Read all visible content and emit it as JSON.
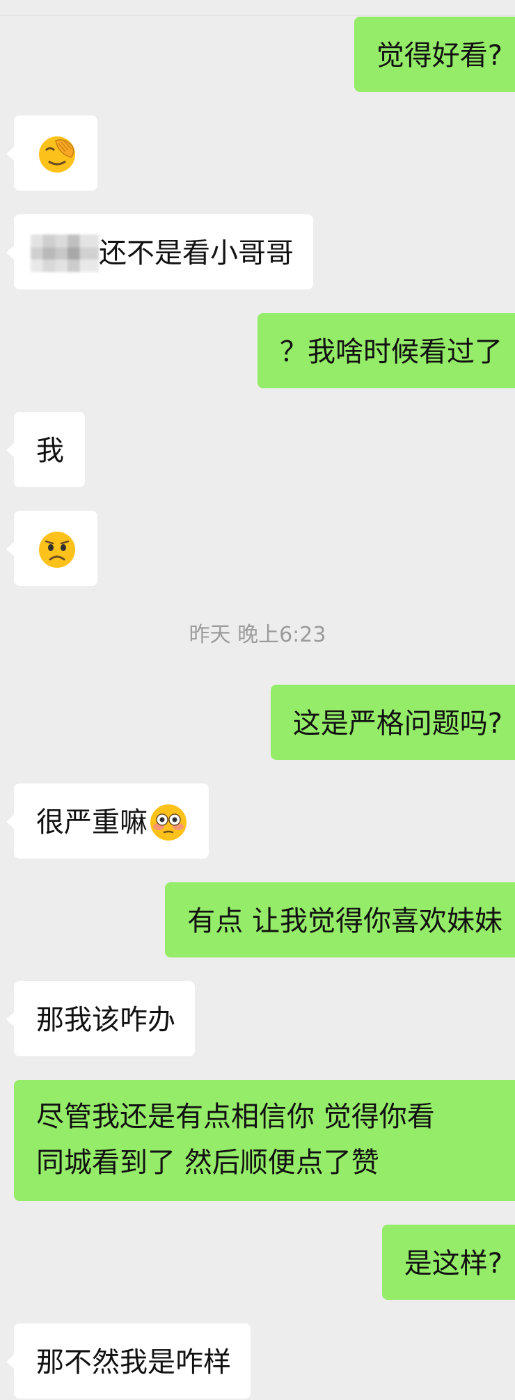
{
  "messages": [
    {
      "id": "m1",
      "side": "out",
      "text": "觉得好看?"
    },
    {
      "id": "m2",
      "side": "in",
      "emoji": "face-palm-emoji"
    },
    {
      "id": "m3",
      "side": "in",
      "text": "还不是看小哥哥"
    },
    {
      "id": "m4",
      "side": "out",
      "text": "？我啥时候看过了"
    },
    {
      "id": "m5",
      "side": "in",
      "text": "我"
    },
    {
      "id": "m6",
      "side": "in",
      "emoji": "frowning-face-emoji"
    },
    {
      "id": "m7",
      "side": "out",
      "text": "这是严格问题吗?"
    },
    {
      "id": "m8",
      "side": "in",
      "text": "很严重嘛",
      "emoji": "flushed-face-emoji"
    },
    {
      "id": "m9",
      "side": "out",
      "text": "有点 让我觉得你喜欢妹妹"
    },
    {
      "id": "m10",
      "side": "in",
      "text": "那我该咋办"
    },
    {
      "id": "m11",
      "side": "out",
      "lines": [
        "尽管我还是有点相信你 觉得你看",
        "同城看到了 然后顺便点了赞"
      ]
    },
    {
      "id": "m12",
      "side": "out",
      "text": "是这样?"
    },
    {
      "id": "m13",
      "side": "in",
      "text": "那不然我是咋样"
    }
  ],
  "timestamp": "昨天 晚上6:23",
  "colors": {
    "background": "#ededed",
    "outgoing_bubble": "#95ec69",
    "incoming_bubble": "#ffffff",
    "timestamp_text": "#9b9b9b"
  }
}
